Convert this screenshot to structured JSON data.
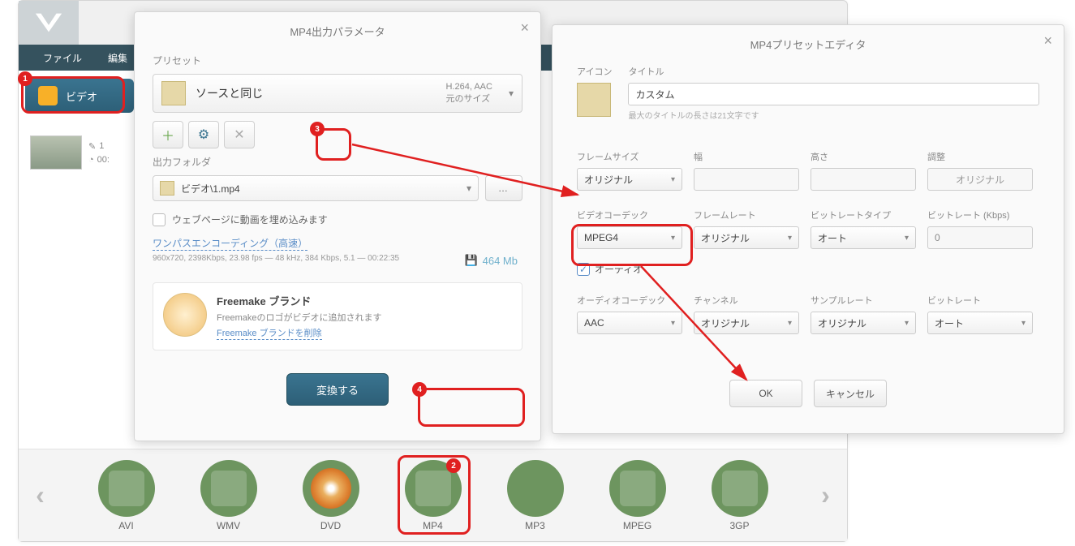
{
  "main": {
    "menu": {
      "file": "ファイル",
      "edit": "編集"
    },
    "video_btn": "ビデオ",
    "clip": {
      "count": "1",
      "time": "00:"
    },
    "formats": [
      "AVI",
      "WMV",
      "DVD",
      "MP4",
      "MP3",
      "MPEG",
      "3GP"
    ]
  },
  "dialog1": {
    "title": "MP4出力パラメータ",
    "preset_label": "プリセット",
    "preset_name": "ソースと同じ",
    "preset_codec": "H.264, AAC",
    "preset_size": "元のサイズ",
    "output_label": "出力フォルダ",
    "output_path": "ビデオ\\1.mp4",
    "embed_label": "ウェブページに動画を埋め込みます",
    "encoding_link": "ワンパスエンコーディング（高速）",
    "encoding_info": "960x720, 2398Kbps, 23.98 fps — 48 kHz, 384 Kbps, 5.1 — 00:22:35",
    "size_estimate": "464 Mb",
    "brand_title": "Freemake ブランド",
    "brand_sub": "Freemakeのロゴがビデオに追加されます",
    "brand_link": "Freemake ブランドを削除",
    "convert": "変換する"
  },
  "dialog2": {
    "title": "MP4プリセットエディタ",
    "icon_label": "アイコン",
    "title_label": "タイトル",
    "title_value": "カスタム",
    "title_hint": "最大のタイトルの長さは21文字です",
    "frame_size_label": "フレームサイズ",
    "frame_size": "オリジナル",
    "width_label": "幅",
    "height_label": "高さ",
    "adjust_label": "調整",
    "adjust_value": "オリジナル",
    "vcodec_label": "ビデオコーデック",
    "vcodec": "MPEG4",
    "framerate_label": "フレームレート",
    "framerate": "オリジナル",
    "btype_label": "ビットレートタイプ",
    "btype": "オート",
    "bitrate_label": "ビットレート (Kbps)",
    "bitrate": "0",
    "audio_label": "オーディオ",
    "acodec_label": "オーディオコーデック",
    "acodec": "AAC",
    "channels_label": "チャンネル",
    "channels": "オリジナル",
    "samplerate_label": "サンプルレート",
    "samplerate": "オリジナル",
    "abitrate_label": "ビットレート",
    "abitrate": "オート",
    "ok": "OK",
    "cancel": "キャンセル"
  }
}
